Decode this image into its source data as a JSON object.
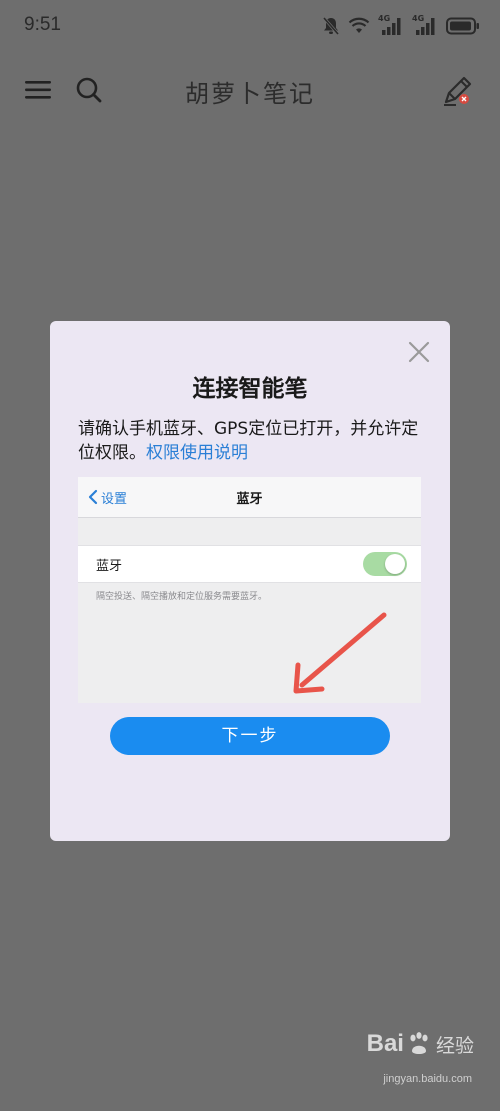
{
  "status_bar": {
    "time": "9:51",
    "icons": [
      "mute-bell-icon",
      "wifi-icon",
      "signal-4g-icon",
      "signal-4g-icon",
      "battery-icon"
    ],
    "network_labels": [
      "4G",
      "4G"
    ]
  },
  "app_bar": {
    "title": "胡萝卜笔记",
    "icons": [
      "menu-icon",
      "search-icon",
      "pen-icon"
    ]
  },
  "dialog": {
    "title": "连接智能笔",
    "message": "请确认手机蓝牙、GPS定位已打开，并允许定位权限。",
    "link": "权限使用说明",
    "ios_screenshot": {
      "back_label": "设置",
      "nav_title": "蓝牙",
      "row_label": "蓝牙",
      "toggle_on": true,
      "footnote": "隔空投送、隔空播放和定位服务需要蓝牙。"
    },
    "next_button": "下一步"
  },
  "watermark": {
    "brand_left": "Bai",
    "brand_right": "经验",
    "url": "jingyan.baidu.com"
  },
  "colors": {
    "backdrop": "#6e6e6e",
    "dialog_bg": "#ece7f3",
    "primary": "#1a8cf0",
    "link": "#2a7fd6",
    "toggle_on": "#a8dba3",
    "arrow": "#e8544a"
  }
}
